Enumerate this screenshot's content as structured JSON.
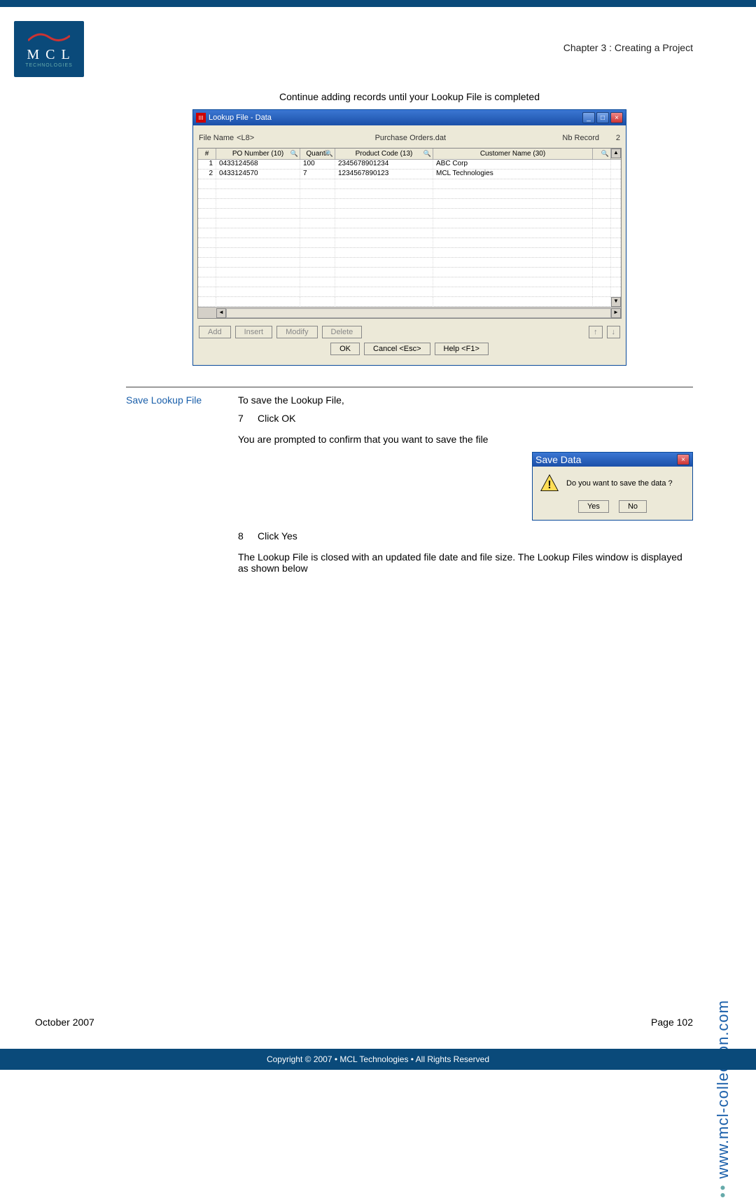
{
  "chapter": "Chapter 3 : Creating a Project",
  "logo": {
    "line1": "M C L",
    "line2": "TECHNOLOGIES"
  },
  "intro": "Continue adding records until your Lookup File is completed",
  "dialog": {
    "title": "Lookup File - Data",
    "file_name_label": "File Name",
    "file_name_code": "<L8>",
    "file_name_value": "Purchase Orders.dat",
    "nb_record_label": "Nb Record",
    "nb_record_value": "2",
    "columns": {
      "idx": "#",
      "po": "PO Number (10)",
      "qty": "Quantit",
      "prod": "Product Code (13)",
      "cust": "Customer Name (30)"
    },
    "rows": [
      {
        "idx": "1",
        "po": "0433124568",
        "qty": "100",
        "prod": "2345678901234",
        "cust": "ABC Corp"
      },
      {
        "idx": "2",
        "po": "0433124570",
        "qty": "7",
        "prod": "1234567890123",
        "cust": "MCL Technologies"
      }
    ],
    "buttons": {
      "add": "Add",
      "insert": "Insert",
      "modify": "Modify",
      "delete": "Delete",
      "up": "↑",
      "down": "↓",
      "ok": "OK",
      "cancel": "Cancel <Esc>",
      "help": "Help <F1>"
    }
  },
  "section": {
    "label": "Save Lookup File",
    "line1": "To save the Lookup File,",
    "step7_n": "7",
    "step7": "Click OK",
    "line2": "You are prompted to confirm that you want to save the file",
    "step8_n": "8",
    "step8": "Click Yes",
    "line3": "The Lookup File is closed with an updated file date and file size. The Lookup Files window is displayed as shown below"
  },
  "savebox": {
    "title": "Save Data",
    "msg": "Do you want to save the data ?",
    "yes": "Yes",
    "no": "No"
  },
  "sidebar": "www.mcl-collection.com",
  "footer": {
    "left": "October 2007",
    "right": "Page 102"
  },
  "copyright": "Copyright © 2007 • MCL Technologies • All Rights Reserved"
}
